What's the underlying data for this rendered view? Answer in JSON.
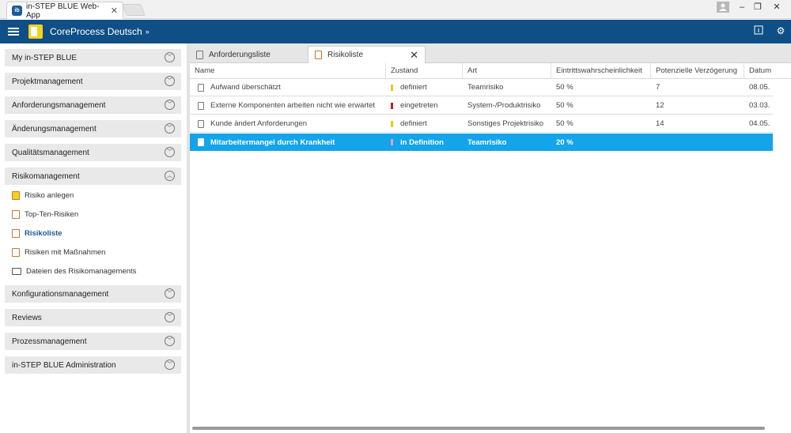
{
  "browser": {
    "tab_title": "in-STEP BLUE Web-App",
    "tab_logo": "ib"
  },
  "app": {
    "title": "CoreProcess Deutsch",
    "title_chevron": "»"
  },
  "sidebar": {
    "sections": [
      {
        "label": "My in-STEP BLUE",
        "expanded": false
      },
      {
        "label": "Projektmanagement",
        "expanded": false
      },
      {
        "label": "Anforderungsmanagement",
        "expanded": false
      },
      {
        "label": "Änderungsmanagement",
        "expanded": false
      },
      {
        "label": "Qualitätsmanagement",
        "expanded": false
      },
      {
        "label": "Risikomanagement",
        "expanded": true
      },
      {
        "label": "Konfigurationsmanagement",
        "expanded": false
      },
      {
        "label": "Reviews",
        "expanded": false
      },
      {
        "label": "Prozessmanagement",
        "expanded": false
      },
      {
        "label": "in-STEP BLUE Administration",
        "expanded": false
      }
    ],
    "risk_items": [
      {
        "label": "Risiko anlegen",
        "icon": "new-risk-icon"
      },
      {
        "label": "Top-Ten-Risiken",
        "icon": "document-icon"
      },
      {
        "label": "Risikoliste",
        "icon": "document-icon",
        "active": true
      },
      {
        "label": "Risiken mit Maßnahmen",
        "icon": "document-icon"
      },
      {
        "label": "Dateien des Risikomanagements",
        "icon": "folder-icon"
      }
    ]
  },
  "tabs": [
    {
      "label": "Anforderungsliste"
    },
    {
      "label": "Risikoliste",
      "active": true,
      "close": "✕"
    }
  ],
  "table": {
    "columns": [
      "Name",
      "Zustand",
      "Art",
      "Eintrittswahrscheinlichkeit",
      "Potenzielle Verzögerung",
      "Datum"
    ],
    "rows": [
      {
        "name": "Aufwand überschätzt",
        "state": "definiert",
        "state_color": "#f5c518",
        "type": "Teamrisiko",
        "probability": "50 %",
        "delay": "7",
        "date": "08.05."
      },
      {
        "name": "Externe Komponenten arbeiten nicht wie erwartet",
        "state": "eingetreten",
        "state_color": "#b22222",
        "type": "System-/Produktrisiko",
        "probability": "50 %",
        "delay": "12",
        "date": "03.03."
      },
      {
        "name": "Kunde ändert Anforderungen",
        "state": "definiert",
        "state_color": "#f5c518",
        "type": "Sonstiges Projektrisiko",
        "probability": "50 %",
        "delay": "14",
        "date": "04.05."
      },
      {
        "name": "Mitarbeitermangel durch Krankheit",
        "state": "in Definition",
        "state_color": "#d9a3c4",
        "type": "Teamrisiko",
        "probability": "20 %",
        "delay": "",
        "date": "",
        "selected": true
      }
    ]
  },
  "colors": {
    "header_bg": "#0f4f86",
    "selection": "#14a4ea"
  }
}
